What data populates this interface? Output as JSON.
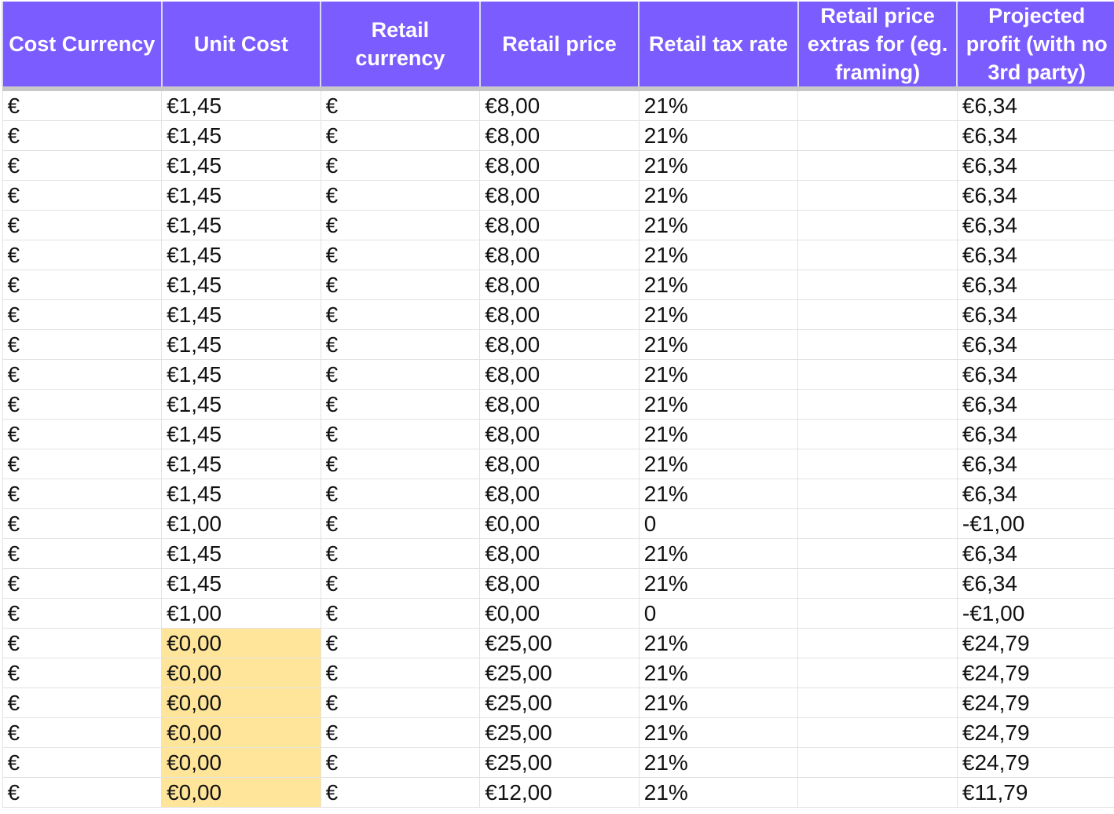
{
  "columns": [
    "Cost Currency",
    "Unit Cost",
    "Retail currency",
    "Retail price",
    "Retail tax rate",
    "Retail price extras for (eg. framing)",
    "Projected profit (with no 3rd party)"
  ],
  "highlight_color": "#ffe599",
  "header_color": "#7b5cff",
  "rows": [
    {
      "cells": [
        "€",
        "€1,45",
        "€",
        "€8,00",
        "21%",
        "",
        "€6,34"
      ],
      "highlight_unit_cost": false
    },
    {
      "cells": [
        "€",
        "€1,45",
        "€",
        "€8,00",
        "21%",
        "",
        "€6,34"
      ],
      "highlight_unit_cost": false
    },
    {
      "cells": [
        "€",
        "€1,45",
        "€",
        "€8,00",
        "21%",
        "",
        "€6,34"
      ],
      "highlight_unit_cost": false
    },
    {
      "cells": [
        "€",
        "€1,45",
        "€",
        "€8,00",
        "21%",
        "",
        "€6,34"
      ],
      "highlight_unit_cost": false
    },
    {
      "cells": [
        "€",
        "€1,45",
        "€",
        "€8,00",
        "21%",
        "",
        "€6,34"
      ],
      "highlight_unit_cost": false
    },
    {
      "cells": [
        "€",
        "€1,45",
        "€",
        "€8,00",
        "21%",
        "",
        "€6,34"
      ],
      "highlight_unit_cost": false
    },
    {
      "cells": [
        "€",
        "€1,45",
        "€",
        "€8,00",
        "21%",
        "",
        "€6,34"
      ],
      "highlight_unit_cost": false
    },
    {
      "cells": [
        "€",
        "€1,45",
        "€",
        "€8,00",
        "21%",
        "",
        "€6,34"
      ],
      "highlight_unit_cost": false
    },
    {
      "cells": [
        "€",
        "€1,45",
        "€",
        "€8,00",
        "21%",
        "",
        "€6,34"
      ],
      "highlight_unit_cost": false
    },
    {
      "cells": [
        "€",
        "€1,45",
        "€",
        "€8,00",
        "21%",
        "",
        "€6,34"
      ],
      "highlight_unit_cost": false
    },
    {
      "cells": [
        "€",
        "€1,45",
        "€",
        "€8,00",
        "21%",
        "",
        "€6,34"
      ],
      "highlight_unit_cost": false
    },
    {
      "cells": [
        "€",
        "€1,45",
        "€",
        "€8,00",
        "21%",
        "",
        "€6,34"
      ],
      "highlight_unit_cost": false
    },
    {
      "cells": [
        "€",
        "€1,45",
        "€",
        "€8,00",
        "21%",
        "",
        "€6,34"
      ],
      "highlight_unit_cost": false
    },
    {
      "cells": [
        "€",
        "€1,45",
        "€",
        "€8,00",
        "21%",
        "",
        "€6,34"
      ],
      "highlight_unit_cost": false
    },
    {
      "cells": [
        "€",
        "€1,00",
        "€",
        "€0,00",
        "0",
        "",
        "-€1,00"
      ],
      "highlight_unit_cost": false
    },
    {
      "cells": [
        "€",
        "€1,45",
        "€",
        "€8,00",
        "21%",
        "",
        "€6,34"
      ],
      "highlight_unit_cost": false
    },
    {
      "cells": [
        "€",
        "€1,45",
        "€",
        "€8,00",
        "21%",
        "",
        "€6,34"
      ],
      "highlight_unit_cost": false
    },
    {
      "cells": [
        "€",
        "€1,00",
        "€",
        "€0,00",
        "0",
        "",
        "-€1,00"
      ],
      "highlight_unit_cost": false
    },
    {
      "cells": [
        "€",
        "€0,00",
        "€",
        "€25,00",
        "21%",
        "",
        "€24,79"
      ],
      "highlight_unit_cost": true
    },
    {
      "cells": [
        "€",
        "€0,00",
        "€",
        "€25,00",
        "21%",
        "",
        "€24,79"
      ],
      "highlight_unit_cost": true
    },
    {
      "cells": [
        "€",
        "€0,00",
        "€",
        "€25,00",
        "21%",
        "",
        "€24,79"
      ],
      "highlight_unit_cost": true
    },
    {
      "cells": [
        "€",
        "€0,00",
        "€",
        "€25,00",
        "21%",
        "",
        "€24,79"
      ],
      "highlight_unit_cost": true
    },
    {
      "cells": [
        "€",
        "€0,00",
        "€",
        "€25,00",
        "21%",
        "",
        "€24,79"
      ],
      "highlight_unit_cost": true
    },
    {
      "cells": [
        "€",
        "€0,00",
        "€",
        "€12,00",
        "21%",
        "",
        "€11,79"
      ],
      "highlight_unit_cost": true
    }
  ]
}
